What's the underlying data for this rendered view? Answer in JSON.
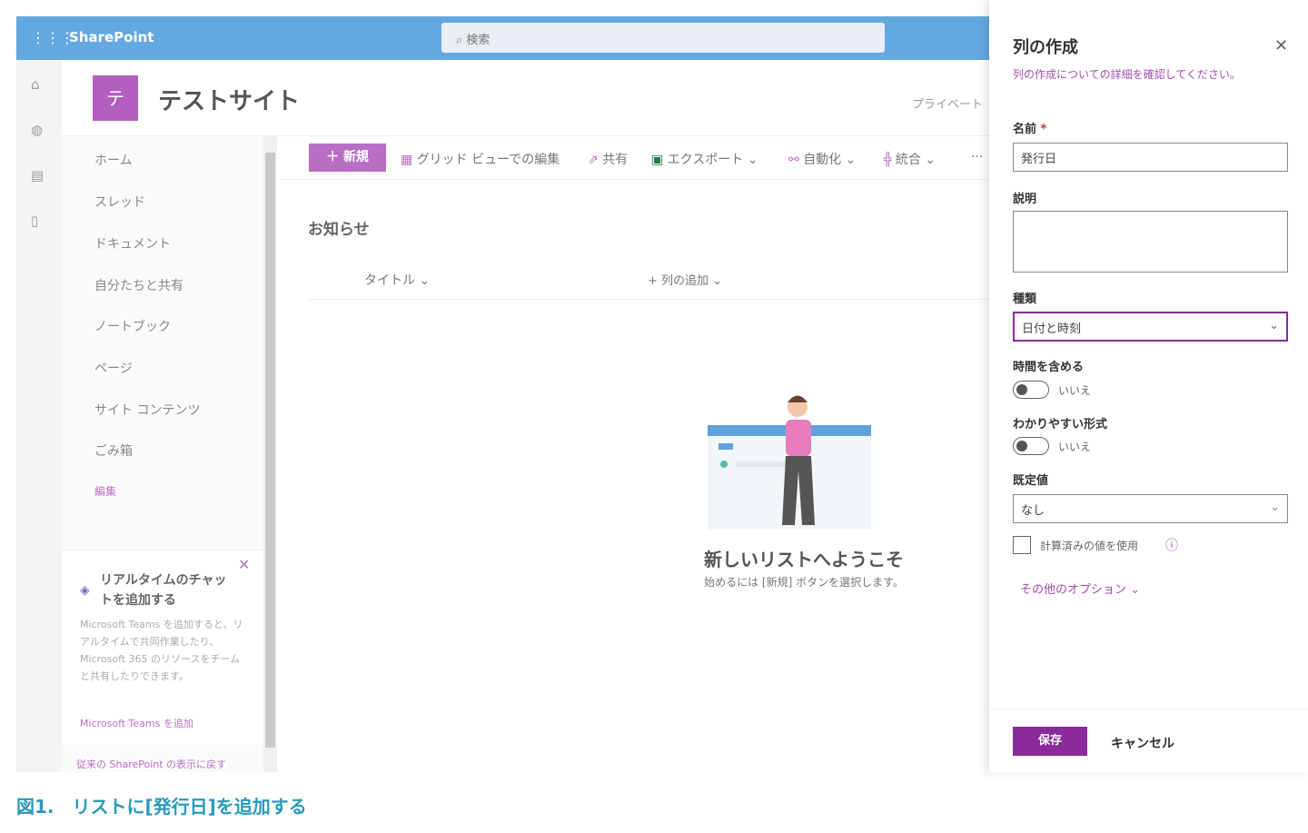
{
  "topbar": {
    "app_name": "SharePoint",
    "search_placeholder": "検索"
  },
  "site": {
    "logo_letter": "テ",
    "title": "テストサイト",
    "privacy": "プライベート"
  },
  "nav": {
    "items": [
      "ホーム",
      "スレッド",
      "ドキュメント",
      "自分たちと共有",
      "ノートブック",
      "ページ",
      "サイト コンテンツ",
      "ごみ箱",
      "編集"
    ]
  },
  "teams_card": {
    "title": "リアルタイムのチャットを追加する",
    "body": "Microsoft Teams を追加すると、リアルタイムで共同作業したり、Microsoft 365 のリソースをチームと共有したりできます。",
    "link": "Microsoft Teams を追加",
    "classic": "従来の SharePoint の表示に戻す"
  },
  "commands": {
    "new": "新規",
    "grid": "グリッド ビューでの編集",
    "share": "共有",
    "export": "エクスポート",
    "automate": "自動化",
    "integrate": "統合",
    "more": "···"
  },
  "list": {
    "title": "お知らせ",
    "col_title": "タイトル",
    "add_column": "列の追加",
    "empty_title": "新しいリストへようこそ",
    "empty_sub": "始めるには [新規] ボタンを選択します。"
  },
  "panel": {
    "title": "列の作成",
    "help": "列の作成についての詳細を確認してください。",
    "name_label": "名前",
    "required": "*",
    "name_value": "発行日",
    "desc_label": "説明",
    "type_label": "種類",
    "type_value": "日付と時刻",
    "time_label": "時間を含める",
    "time_value": "いいえ",
    "friendly_label": "わかりやすい形式",
    "friendly_value": "いいえ",
    "default_label": "既定値",
    "default_value": "なし",
    "calc_label": "計算済みの値を使用",
    "more_options": "その他のオプション",
    "save": "保存",
    "cancel": "キャンセル"
  },
  "caption": "図1.　リストに[発行日]を追加する",
  "colors": {
    "topbar": "#64a8e2",
    "accent": "#8a2a9b",
    "caption": "#2a9ab8"
  }
}
